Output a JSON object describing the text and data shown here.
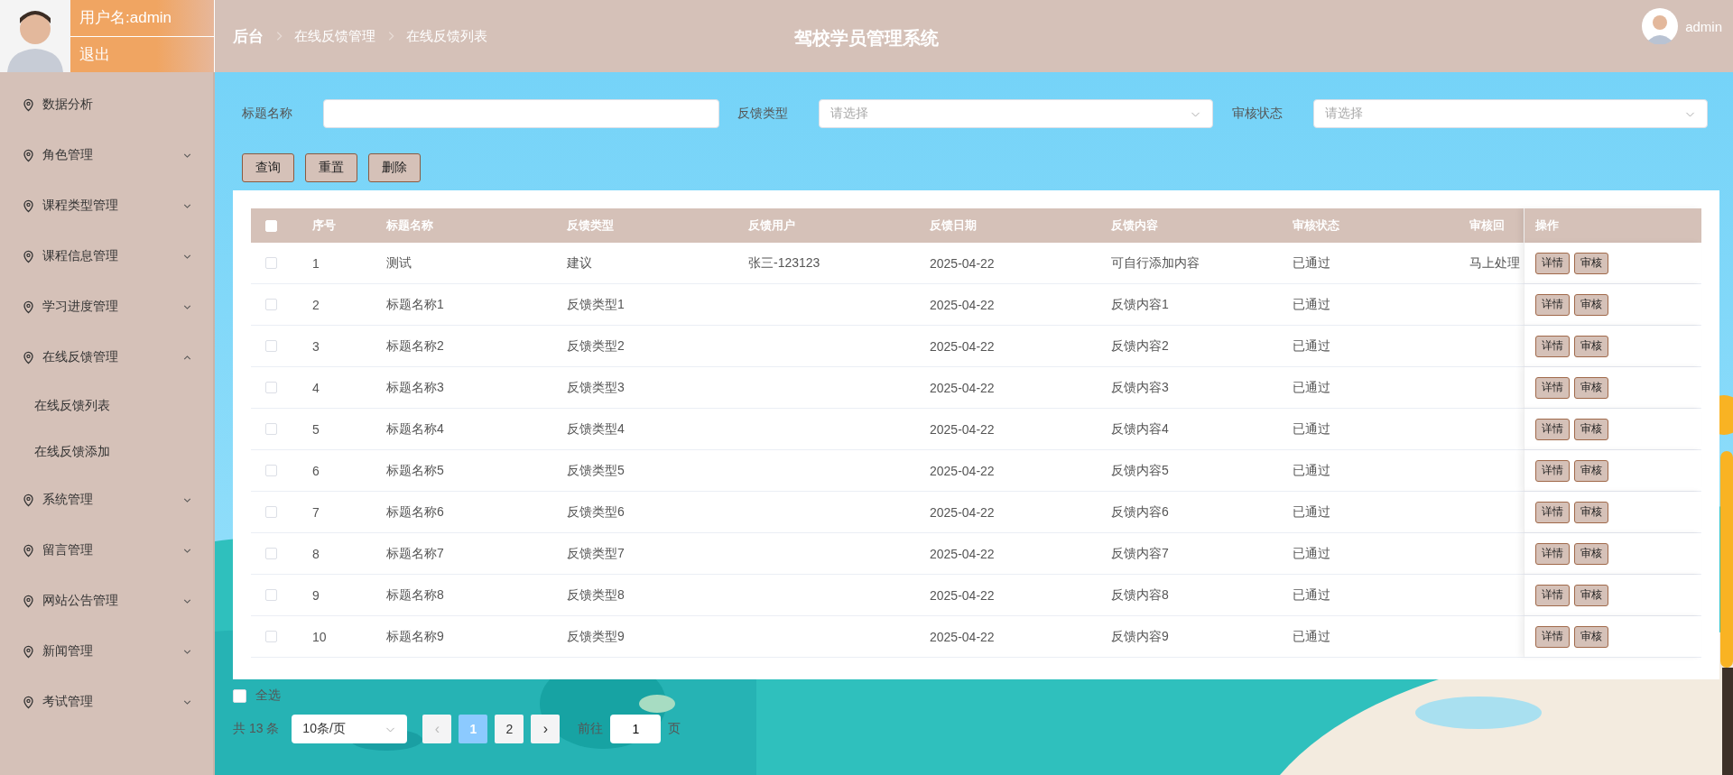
{
  "user_panel": {
    "username": "用户名:admin",
    "logout": "退出"
  },
  "breadcrumb": [
    {
      "label": "后台",
      "kind": "root"
    },
    {
      "label": "在线反馈管理",
      "kind": "link"
    },
    {
      "label": "在线反馈列表",
      "kind": "link"
    }
  ],
  "title": "驾校学员管理系统",
  "account": {
    "name": "admin"
  },
  "sidebar": {
    "items": [
      {
        "label": "数据分析",
        "kind": "link"
      },
      {
        "label": "角色管理",
        "kind": "group",
        "expanded": false
      },
      {
        "label": "课程类型管理",
        "kind": "group",
        "expanded": false
      },
      {
        "label": "课程信息管理",
        "kind": "group",
        "expanded": false
      },
      {
        "label": "学习进度管理",
        "kind": "group",
        "expanded": false
      },
      {
        "label": "在线反馈管理",
        "kind": "group",
        "expanded": true,
        "children": [
          {
            "label": "在线反馈列表"
          },
          {
            "label": "在线反馈添加"
          }
        ]
      },
      {
        "label": "系统管理",
        "kind": "group",
        "expanded": false
      },
      {
        "label": "留言管理",
        "kind": "group",
        "expanded": false
      },
      {
        "label": "网站公告管理",
        "kind": "group",
        "expanded": false
      },
      {
        "label": "新闻管理",
        "kind": "group",
        "expanded": false
      },
      {
        "label": "考试管理",
        "kind": "group",
        "expanded": false
      }
    ]
  },
  "filters": [
    {
      "label": "标题名称",
      "kind": "input"
    },
    {
      "label": "反馈类型",
      "kind": "select",
      "placeholder": "请选择"
    },
    {
      "label": "审核状态",
      "kind": "select",
      "placeholder": "请选择"
    }
  ],
  "buttons": [
    "查询",
    "重置",
    "删除"
  ],
  "table": {
    "header_checked": false,
    "columns": [
      "序号",
      "标题名称",
      "反馈类型",
      "反馈用户",
      "反馈日期",
      "反馈内容",
      "审核状态",
      "审核回"
    ],
    "action_column": "操作",
    "rows": [
      {
        "checked": false,
        "cells": [
          "1",
          "测试",
          "建议",
          "张三-123123",
          "2025-04-22",
          "可自行添加内容",
          "已通过",
          "马上处理"
        ],
        "actions": [
          "详情",
          "审核"
        ]
      },
      {
        "checked": false,
        "cells": [
          "2",
          "标题名称1",
          "反馈类型1",
          "",
          "2025-04-22",
          "反馈内容1",
          "已通过",
          ""
        ],
        "actions": [
          "详情",
          "审核"
        ]
      },
      {
        "checked": false,
        "cells": [
          "3",
          "标题名称2",
          "反馈类型2",
          "",
          "2025-04-22",
          "反馈内容2",
          "已通过",
          ""
        ],
        "actions": [
          "详情",
          "审核"
        ]
      },
      {
        "checked": false,
        "cells": [
          "4",
          "标题名称3",
          "反馈类型3",
          "",
          "2025-04-22",
          "反馈内容3",
          "已通过",
          ""
        ],
        "actions": [
          "详情",
          "审核"
        ]
      },
      {
        "checked": false,
        "cells": [
          "5",
          "标题名称4",
          "反馈类型4",
          "",
          "2025-04-22",
          "反馈内容4",
          "已通过",
          ""
        ],
        "actions": [
          "详情",
          "审核"
        ]
      },
      {
        "checked": false,
        "cells": [
          "6",
          "标题名称5",
          "反馈类型5",
          "",
          "2025-04-22",
          "反馈内容5",
          "已通过",
          ""
        ],
        "actions": [
          "详情",
          "审核"
        ]
      },
      {
        "checked": false,
        "cells": [
          "7",
          "标题名称6",
          "反馈类型6",
          "",
          "2025-04-22",
          "反馈内容6",
          "已通过",
          ""
        ],
        "actions": [
          "详情",
          "审核"
        ]
      },
      {
        "checked": false,
        "cells": [
          "8",
          "标题名称7",
          "反馈类型7",
          "",
          "2025-04-22",
          "反馈内容7",
          "已通过",
          ""
        ],
        "actions": [
          "详情",
          "审核"
        ]
      },
      {
        "checked": false,
        "cells": [
          "9",
          "标题名称8",
          "反馈类型8",
          "",
          "2025-04-22",
          "反馈内容8",
          "已通过",
          ""
        ],
        "actions": [
          "详情",
          "审核"
        ]
      },
      {
        "checked": false,
        "cells": [
          "10",
          "标题名称9",
          "反馈类型9",
          "",
          "2025-04-22",
          "反馈内容9",
          "已通过",
          ""
        ],
        "actions": [
          "详情",
          "审核"
        ]
      }
    ]
  },
  "select_all": {
    "label": "全选",
    "checked": false
  },
  "pagination": {
    "total": "共 13 条",
    "page_size": "10条/页",
    "prev": "‹",
    "next": "›",
    "pages": [
      {
        "label": "1",
        "selected": true
      },
      {
        "label": "2",
        "selected": false
      }
    ],
    "goto_label": "前往",
    "goto_value": "1",
    "page_suffix": "页"
  }
}
